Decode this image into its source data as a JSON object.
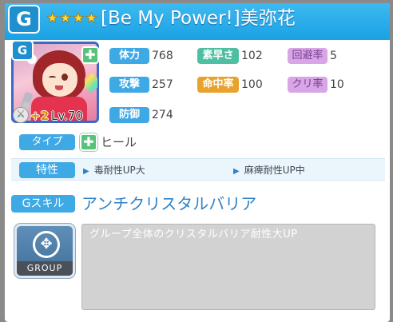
{
  "header": {
    "badge_icon": "g-emblem-icon",
    "stars": [
      "★",
      "★",
      "★",
      "★"
    ],
    "title": "[Be My Power!]美弥花"
  },
  "portrait": {
    "rarity_badge": "G",
    "type_badge": "✚",
    "plus": "+2",
    "level": "Lv.70"
  },
  "stats": {
    "hp_label": "体力",
    "hp_value": "768",
    "attack_label": "攻撃",
    "attack_value": "257",
    "defense_label": "防御",
    "defense_value": "274",
    "speed_label": "素早さ",
    "speed_value": "102",
    "accuracy_label": "命中率",
    "accuracy_value": "100",
    "evasion_label": "回避率",
    "evasion_value": "5",
    "crit_label": "クリ率",
    "crit_value": "10"
  },
  "type": {
    "label": "タイプ",
    "value": "ヒール"
  },
  "traits": {
    "label": "特性",
    "items": [
      "毒耐性UP大",
      "麻痺耐性UP中"
    ]
  },
  "gskill": {
    "label": "Gスキル",
    "name": "アンチクリスタルバリア",
    "icon_label": "GROUP",
    "description": "グループ全体のクリスタルバリア耐性大UP"
  },
  "colors": {
    "header": "#1aa2e4",
    "label_blue": "#3fa9e6",
    "label_green": "#4ebfa2",
    "label_purple": "#d8a6e6",
    "label_orange": "#e8a22e",
    "skill_name": "#2f82c8"
  }
}
